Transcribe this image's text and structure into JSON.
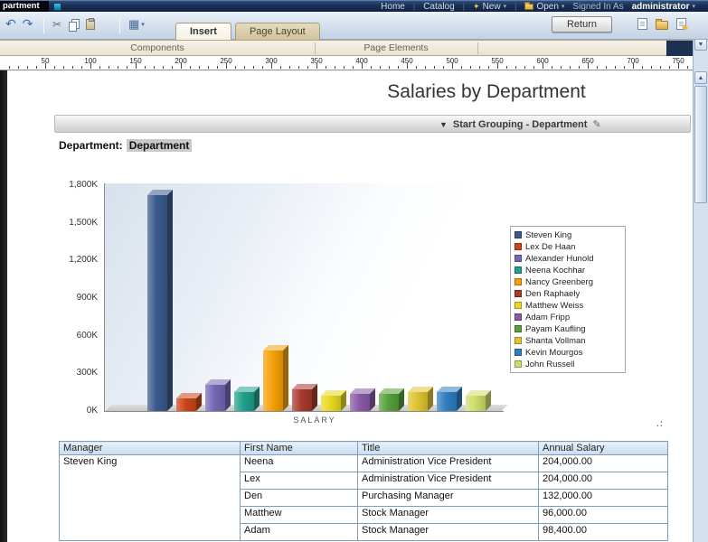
{
  "icons": {
    "caret_down": "▾",
    "grouping_collapse": "▼",
    "pencil": "✎",
    "undo": "↶",
    "redo": "↷",
    "cut": "✂",
    "grid_picker": "▦",
    "new_star": "✦",
    "scroll_up": "▲",
    "scroll_down": "▼",
    "separator": "|"
  },
  "chrome": {
    "window_tab": "partment",
    "menu": {
      "home": "Home",
      "catalog": "Catalog",
      "new_label": "New",
      "open_label": "Open",
      "signed_in_prefix": "Signed In As",
      "user": "administrator"
    },
    "toolbar": {
      "tabs": {
        "insert": "Insert",
        "page_layout": "Page Layout"
      },
      "return_button": "Return"
    },
    "ribbon": {
      "components": "Components",
      "page_elements": "Page Elements"
    },
    "ruler_marks": [
      50,
      100,
      150,
      200,
      250,
      300,
      350,
      400,
      450,
      500,
      550,
      600,
      650,
      700,
      750
    ]
  },
  "report": {
    "title": "Salaries by Department",
    "grouping_bar_label": "Start Grouping - Department",
    "department_label": "Department:",
    "department_value": "Department",
    "resize_handle": ".:"
  },
  "chart_data": {
    "type": "bar",
    "title": "",
    "xlabel": "SALARY",
    "ylabel": "",
    "ylim": [
      0,
      1800
    ],
    "ytick_labels": [
      "1,800K",
      "1,500K",
      "1,200K",
      "900K",
      "600K",
      "300K",
      "0K"
    ],
    "ytick_values": [
      1800,
      1500,
      1200,
      900,
      600,
      300,
      0
    ],
    "legend_position": "right",
    "categories": [
      "Steven King",
      "Lex De Haan",
      "Alexander Hunold",
      "Neena Kochhar",
      "Nancy Greenberg",
      "Den Raphaely",
      "Matthew Weiss",
      "Adam Fripp",
      "Payam Kaufling",
      "Shanta Vollman",
      "Kevin Mourgos",
      "John Russell"
    ],
    "values_k": [
      1720,
      100,
      210,
      150,
      480,
      170,
      125,
      140,
      140,
      150,
      150,
      120
    ],
    "colors": [
      "#3a5a8c",
      "#cc4517",
      "#7467b4",
      "#21a08c",
      "#f5a008",
      "#a8392e",
      "#e8d820",
      "#8a5aa8",
      "#56a03c",
      "#e0c433",
      "#2f7fc1",
      "#cfdd6a"
    ]
  },
  "table": {
    "headers": [
      "Manager",
      "First Name",
      "Title",
      "Annual Salary"
    ],
    "manager": "Steven King",
    "rows": [
      [
        "Neena",
        "Administration Vice President",
        "204,000.00"
      ],
      [
        "Lex",
        "Administration Vice President",
        "204,000.00"
      ],
      [
        "Den",
        "Purchasing Manager",
        "132,000.00"
      ],
      [
        "Matthew",
        "Stock Manager",
        "96,000.00"
      ],
      [
        "Adam",
        "Stock Manager",
        "98,400.00"
      ]
    ]
  }
}
